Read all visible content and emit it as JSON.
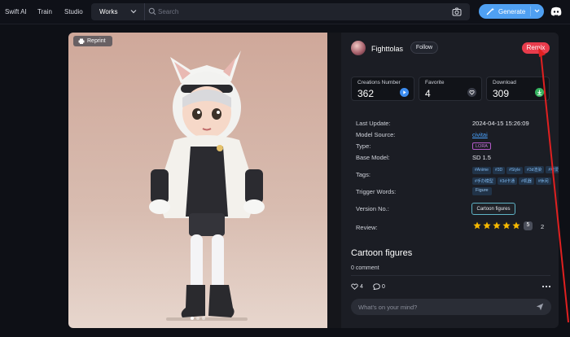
{
  "nav": {
    "links": [
      "Swift AI",
      "Train",
      "Studio"
    ],
    "works_select": "Works",
    "search_placeholder": "Search",
    "generate_label": "Generate"
  },
  "image_panel": {
    "reprint_label": "Reprint",
    "carousel_pages": 3,
    "active_page": 1
  },
  "author": {
    "name": "Fighttolas",
    "follow_label": "Follow",
    "remix_label": "Remix"
  },
  "stats": [
    {
      "label": "Creations Number",
      "value": "362",
      "icon": "play-icon",
      "color": "#3d8df0"
    },
    {
      "label": "Favorite",
      "value": "4",
      "icon": "heart-icon",
      "color": "#3a3d48"
    },
    {
      "label": "Download",
      "value": "309",
      "icon": "download-icon",
      "color": "#35b35f"
    }
  ],
  "details": {
    "last_update_label": "Last Update:",
    "last_update": "2024-04-15 15:26:09",
    "model_source_label": "Model Source:",
    "model_source": "civitai",
    "type_label": "Type:",
    "type": "LORA",
    "base_model_label": "Base Model:",
    "base_model": "SD 1.5",
    "tags_label": "Tags:",
    "tags": [
      "#Anime",
      "#3D",
      "#Style",
      "#3d渲染",
      "#可爱",
      "#手办模型",
      "#3d卡通",
      "#机器",
      "#休闲"
    ],
    "trigger_words_label": "Trigger Words:",
    "trigger_words": [
      "Figure"
    ],
    "version_label": "Version No.:",
    "version": "Cartoon figures",
    "review_label": "Review:",
    "rating": 5,
    "rating_badge": "5",
    "review_count": "2"
  },
  "post": {
    "title": "Cartoon figures",
    "comments": "0 comment",
    "likes": "4",
    "comment_count": "0",
    "comment_placeholder": "What's on your mind?"
  },
  "colors": {
    "accent": "#4fa0f2",
    "remix": "#e83c4c",
    "star": "#f5b700",
    "annotation": "#e02020"
  }
}
